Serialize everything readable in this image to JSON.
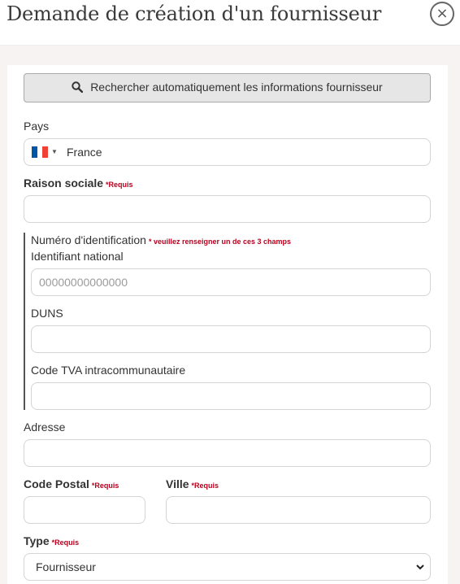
{
  "header": {
    "title": "Demande de création d'un fournisseur",
    "close_icon": "×"
  },
  "search": {
    "label": "Rechercher automatiquement les informations fournisseur",
    "icon": "search-icon"
  },
  "form": {
    "country": {
      "label": "Pays",
      "value": "France",
      "flag": {
        "colors": [
          "#0055a4",
          "#ffffff",
          "#ef4135"
        ]
      }
    },
    "company_name": {
      "label": "Raison sociale",
      "required": "*Requis",
      "value": ""
    },
    "identification": {
      "label": "Numéro d'identification",
      "note": "* veuillez renseigner un de ces 3 champs",
      "national_id": {
        "label": "Identifiant national",
        "placeholder": "00000000000000"
      },
      "duns": {
        "label": "DUNS",
        "value": ""
      },
      "vat": {
        "label": "Code TVA intracommunautaire",
        "value": ""
      }
    },
    "address": {
      "label": "Adresse",
      "value": ""
    },
    "postal_code": {
      "label": "Code Postal",
      "required": "*Requis",
      "value": ""
    },
    "city": {
      "label": "Ville",
      "required": "*Requis",
      "value": ""
    },
    "type": {
      "label": "Type",
      "required": "*Requis",
      "value": "Fournisseur"
    }
  },
  "colors": {
    "required": "#b8001e",
    "backdrop": "#f6f3f2",
    "border": "#d4d4d4"
  }
}
